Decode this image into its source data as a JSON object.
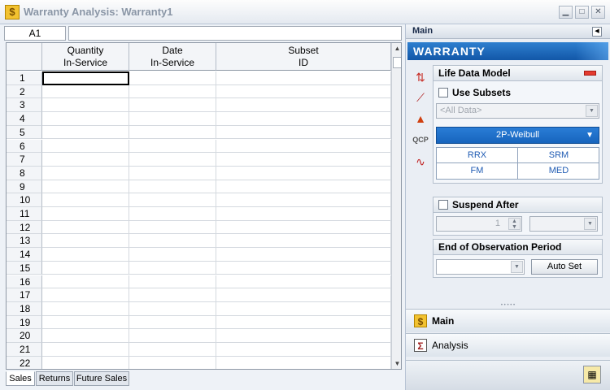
{
  "window": {
    "title": "Warranty Analysis: Warranty1",
    "minimize_glyph": "▁",
    "maximize_glyph": "□",
    "close_glyph": "✕",
    "app_icon": "dollar-icon"
  },
  "formula_bar": {
    "cell_ref": "A1",
    "value": ""
  },
  "grid": {
    "columns": [
      {
        "line1": "Quantity",
        "line2": "In-Service"
      },
      {
        "line1": "Date",
        "line2": "In-Service"
      },
      {
        "line1": "Subset",
        "line2": "ID"
      }
    ],
    "row_labels": [
      "1",
      "2",
      "3",
      "4",
      "5",
      "6",
      "7",
      "8",
      "9",
      "10",
      "11",
      "12",
      "13",
      "14",
      "15",
      "16",
      "17",
      "18",
      "19",
      "20",
      "21",
      "22"
    ],
    "active_cell": "A1"
  },
  "sheet_tabs": [
    "Sales",
    "Returns",
    "Future Sales"
  ],
  "active_sheet": "Sales",
  "right_panel": {
    "header": "Main",
    "banner": "WARRANTY",
    "life_data_model": {
      "title": "Life Data Model",
      "use_subsets_label": "Use Subsets",
      "subset_placeholder": "<All Data>",
      "model": "2P-Weibull",
      "methods": [
        "RRX",
        "SRM",
        "FM",
        "MED"
      ]
    },
    "suspend_after": {
      "title": "Suspend After",
      "value": "1"
    },
    "end_of_observation": {
      "title": "End of Observation Period",
      "auto_set_label": "Auto Set"
    },
    "nav": [
      {
        "label": "Main",
        "icon": "dollar-icon"
      },
      {
        "label": "Analysis",
        "icon": "sigma-icon"
      }
    ]
  },
  "colors": {
    "banner_blue": "#1257a8",
    "model_button_blue": "#1664bd",
    "method_text": "#1f5bb3",
    "red_indicator": "#e43b2f"
  }
}
